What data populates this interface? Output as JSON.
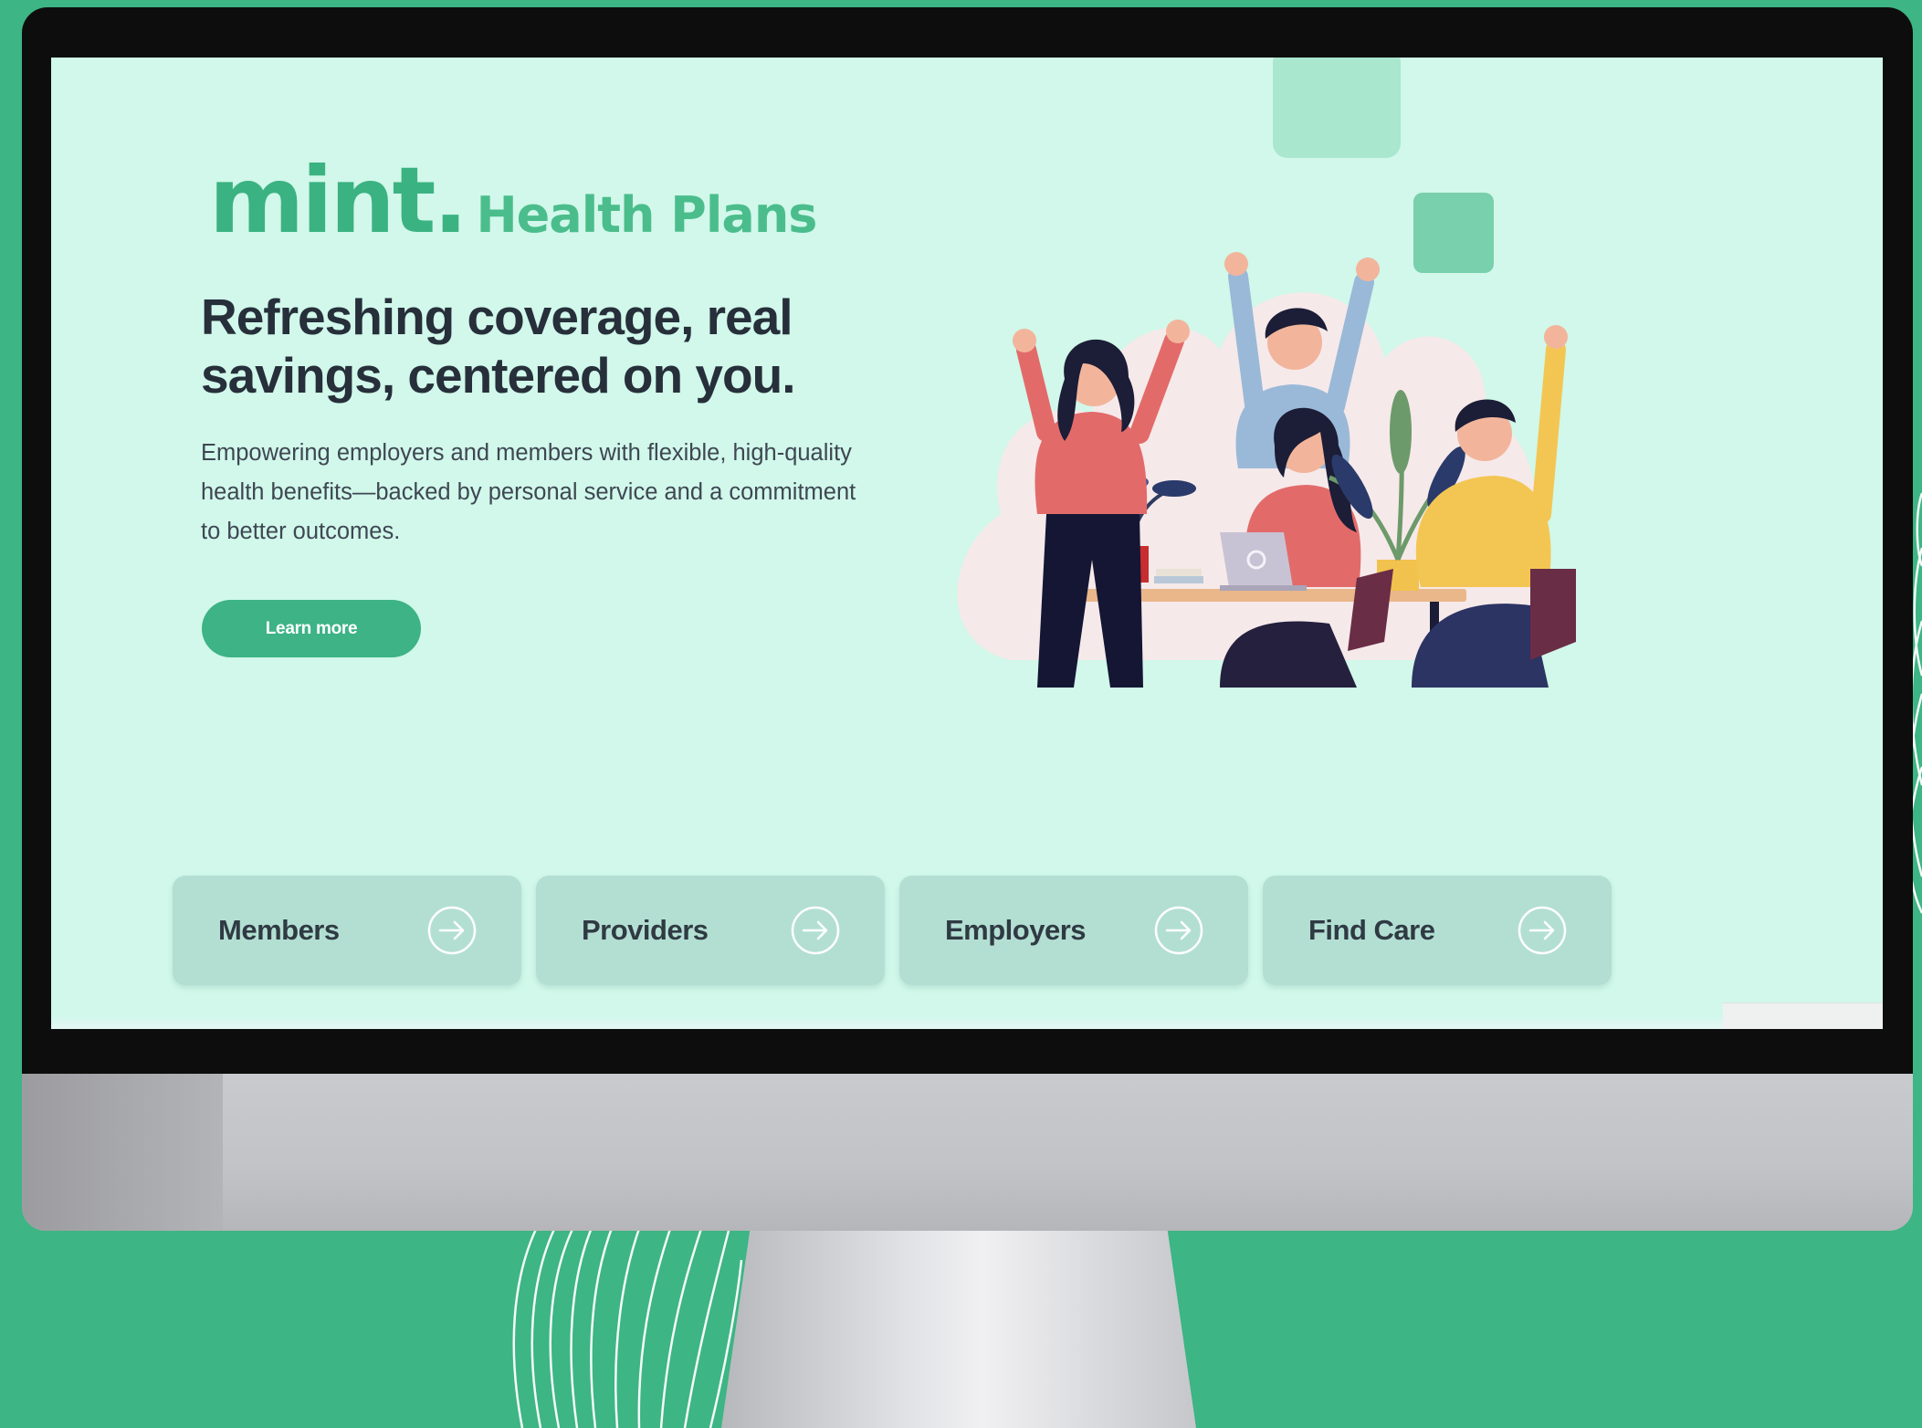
{
  "brand": {
    "name": "mint.",
    "tagline": "Health Plans"
  },
  "hero": {
    "headline": "Refreshing coverage, real savings, centered on you.",
    "subtext": "Empowering employers and members with flexible, high-quality health benefits—backed by personal service and a commitment to better outcomes.",
    "cta_label": "Learn more",
    "illustration": "people-celebrating-illustration"
  },
  "cards": [
    {
      "label": "Members",
      "icon": "arrow-right-circle-icon"
    },
    {
      "label": "Providers",
      "icon": "arrow-right-circle-icon"
    },
    {
      "label": "Employers",
      "icon": "arrow-right-circle-icon"
    },
    {
      "label": "Find Care",
      "icon": "arrow-right-circle-icon"
    }
  ],
  "colors": {
    "background": "#3db584",
    "screen": "#d1f8ea",
    "accent": "#3db386",
    "card": "#b3dfd3",
    "headline": "#262f3a"
  }
}
